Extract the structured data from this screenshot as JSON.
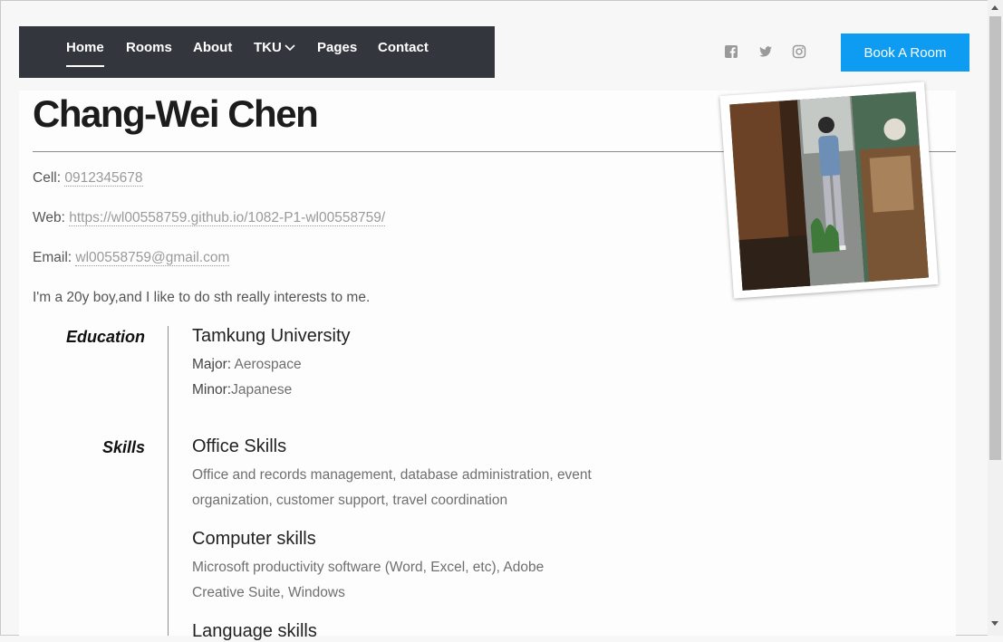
{
  "nav": {
    "items": [
      {
        "label": "Home",
        "active": true
      },
      {
        "label": "Rooms"
      },
      {
        "label": "About"
      },
      {
        "label": "TKU"
      },
      {
        "label": "Pages"
      },
      {
        "label": "Contact"
      }
    ]
  },
  "social": {
    "icons": [
      "facebook-icon",
      "twitter-icon",
      "instagram-icon"
    ]
  },
  "book_button": "Book A Room",
  "profile": {
    "name": "Chang-Wei Chen",
    "cell_label": "Cell:",
    "cell": "0912345678",
    "web_label": "Web:",
    "web": "https://wl00558759.github.io/1082-P1-wl00558759/",
    "email_label": "Email:",
    "email": "wl00558759@gmail.com",
    "bio": "I'm a 20y boy,and I like to do sth really interests to me."
  },
  "education": {
    "title": "Education",
    "school": "Tamkung University",
    "major_label": "Major:",
    "major": " Aerospace",
    "minor_label": "Minor:",
    "minor": "Japanese"
  },
  "skills": {
    "title": "Skills",
    "items": [
      {
        "name": "Office Skills",
        "desc": "Office and records management, database administration, event organization, customer support, travel coordination"
      },
      {
        "name": "Computer skills",
        "desc": "Microsoft productivity software (Word, Excel, etc), Adobe Creative Suite, Windows"
      },
      {
        "name": "Language skills"
      }
    ]
  },
  "colors": {
    "nav_bg": "#33373d",
    "accent": "#0d9cf2"
  }
}
